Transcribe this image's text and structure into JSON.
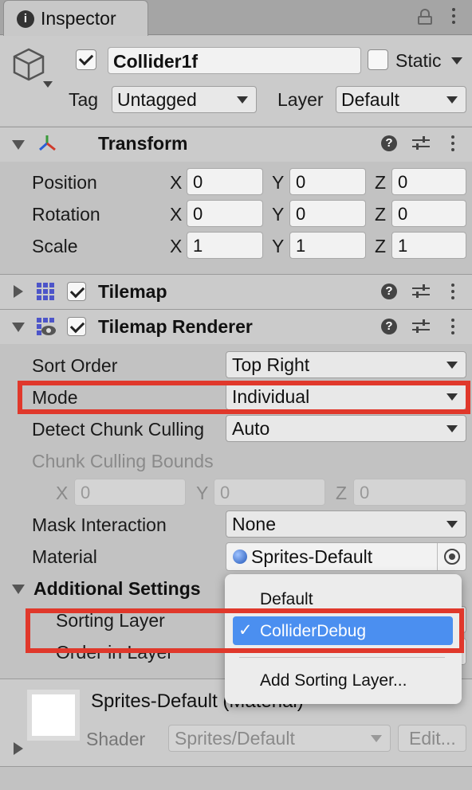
{
  "window": {
    "tab_label": "Inspector",
    "info_glyph": "i"
  },
  "object": {
    "name": "Collider1f",
    "active": true,
    "static_label": "Static",
    "static_checked": false,
    "tag_label": "Tag",
    "tag_value": "Untagged",
    "layer_label": "Layer",
    "layer_value": "Default"
  },
  "transform": {
    "title": "Transform",
    "rows": [
      {
        "label": "Position",
        "x": "0",
        "y": "0",
        "z": "0"
      },
      {
        "label": "Rotation",
        "x": "0",
        "y": "0",
        "z": "0"
      },
      {
        "label": "Scale",
        "x": "1",
        "y": "1",
        "z": "1"
      }
    ],
    "axis": {
      "x": "X",
      "y": "Y",
      "z": "Z"
    }
  },
  "tilemap": {
    "title": "Tilemap",
    "enabled": true
  },
  "renderer": {
    "title": "Tilemap Renderer",
    "enabled": true,
    "sort_order_label": "Sort Order",
    "sort_order_value": "Top Right",
    "mode_label": "Mode",
    "mode_value": "Individual",
    "detect_label": "Detect Chunk Culling",
    "detect_value": "Auto",
    "bounds_label": "Chunk Culling Bounds",
    "bounds": {
      "x": "0",
      "y": "0",
      "z": "0"
    },
    "mask_label": "Mask Interaction",
    "mask_value": "None",
    "material_label": "Material",
    "material_value": "Sprites-Default",
    "additional_label": "Additional Settings",
    "sorting_layer_label": "Sorting Layer",
    "order_label": "Order in Layer"
  },
  "sorting_menu": {
    "items": [
      "Default",
      "ColliderDebug"
    ],
    "selected": "ColliderDebug",
    "check": "✓",
    "add_label": "Add Sorting Layer..."
  },
  "material_section": {
    "title": "Sprites-Default (Material)",
    "shader_label": "Shader",
    "shader_value": "Sprites/Default",
    "edit_label": "Edit..."
  },
  "colors": {
    "highlight": "#e0382b",
    "selection": "#4b8ff0"
  }
}
